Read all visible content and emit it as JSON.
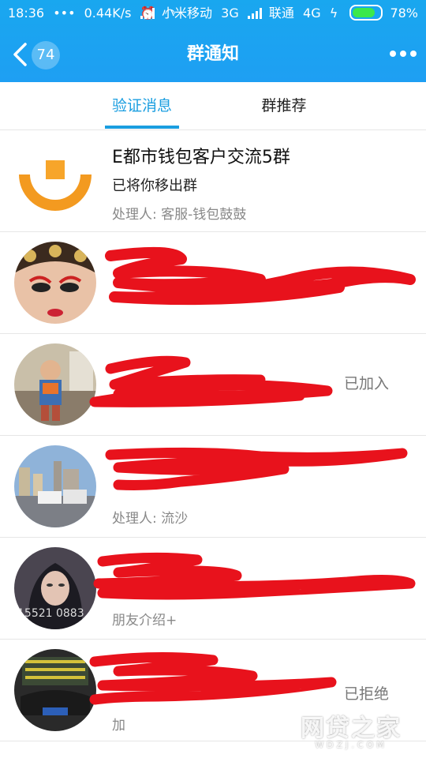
{
  "status_bar": {
    "time": "18:36",
    "dots": "•••",
    "speed": "0.44K/s",
    "carrier1": "小米移动",
    "net1": "3G",
    "carrier2": "联通",
    "net2": "4G",
    "battery": "78%"
  },
  "nav": {
    "back_badge": "74",
    "title": "群通知"
  },
  "tabs": [
    {
      "label": "验证消息",
      "active": true
    },
    {
      "label": "群推荐",
      "active": false
    }
  ],
  "rows": [
    {
      "title": "E都市钱包客户交流5群",
      "subtitle": "已将你移出群",
      "meta": "处理人: 客服-钱包鼓鼓",
      "status": ""
    },
    {
      "title": "",
      "subtitle": "",
      "meta": "",
      "status": ""
    },
    {
      "title": "",
      "subtitle": "",
      "meta": "",
      "status": "已加入"
    },
    {
      "title": "",
      "subtitle": "",
      "meta": "处理人: 流沙",
      "status": ""
    },
    {
      "title": "",
      "subtitle": "",
      "meta": "朋友介绍+",
      "status": "",
      "avatar_text": "15521 0883"
    },
    {
      "title": "",
      "subtitle": "",
      "meta": "加",
      "status": "已拒绝"
    }
  ],
  "watermark": {
    "main": "网贷之家",
    "sub": "WDZJ.COM"
  },
  "colors": {
    "accent": "#1a9ee0",
    "header": "#1ea3f0",
    "redact": "#e8121c"
  }
}
